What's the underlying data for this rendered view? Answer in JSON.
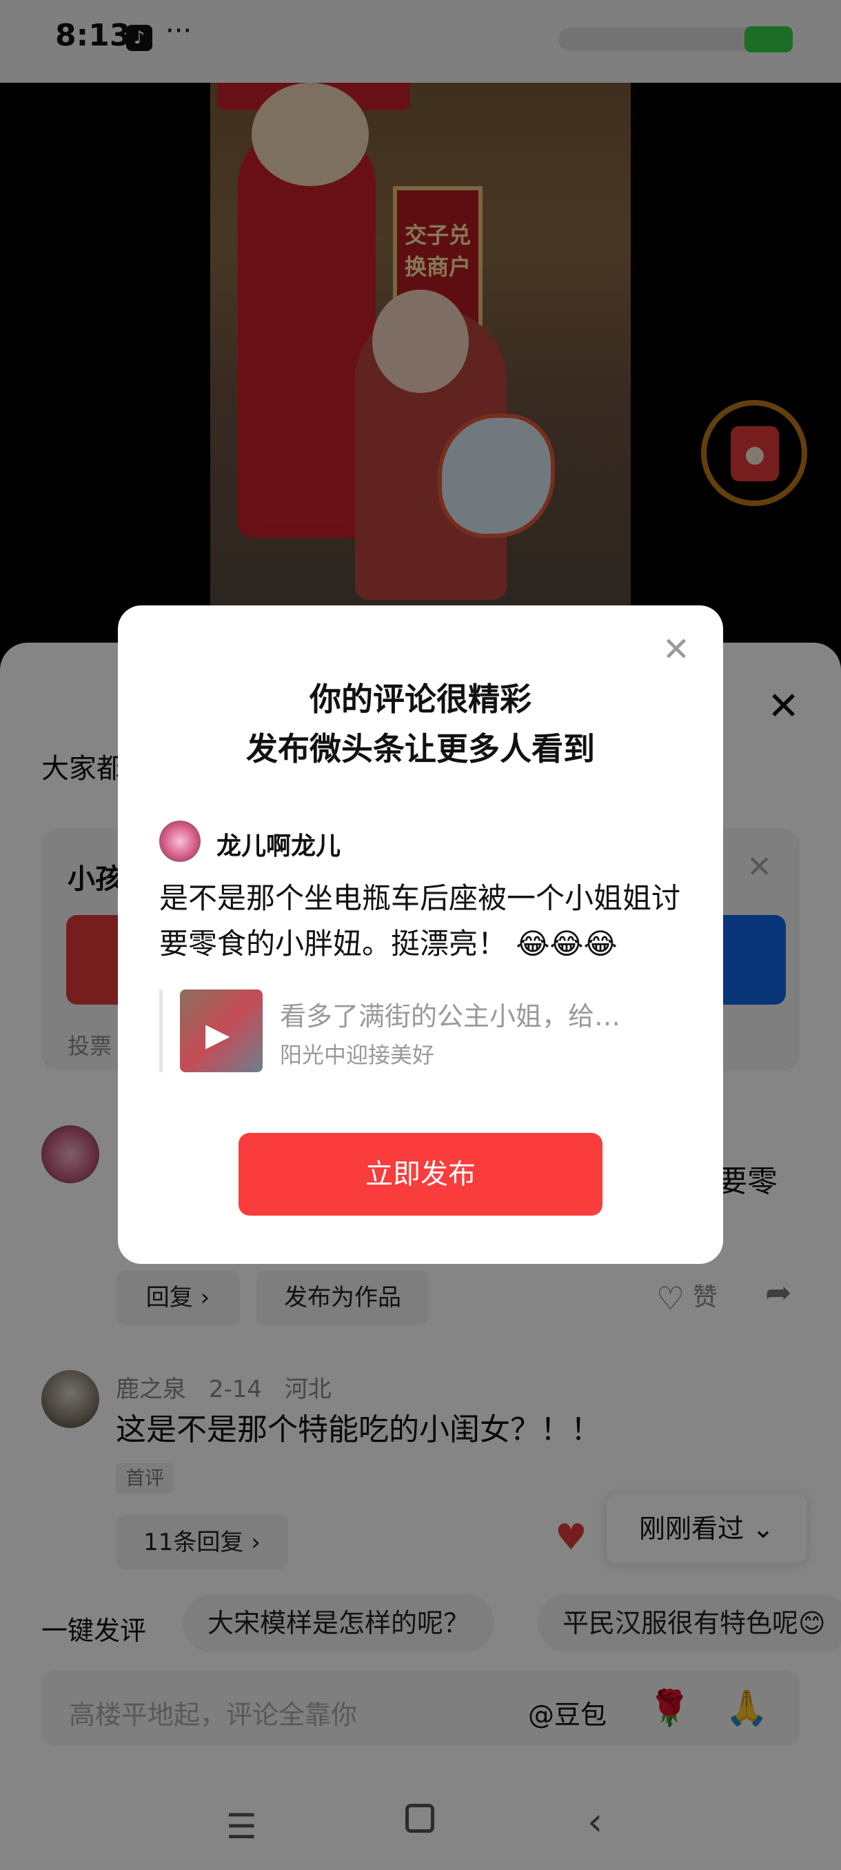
{
  "status": {
    "time": "8:13"
  },
  "comments_sheet": {
    "heading_partial": "大家都",
    "vote": {
      "title_partial": "小孩",
      "label_partial": "投票"
    },
    "comment1": {
      "tail_text": "要零",
      "reply_label": "回复 ›",
      "publish_as_work_label": "发布为作品",
      "like_label": "赞"
    },
    "comment2": {
      "user": "鹿之泉",
      "date": "2-14",
      "location": "河北",
      "text": "这是不是那个特能吃的小闺女？！！",
      "tag": "首评",
      "replies_label": "11条回复 ›"
    },
    "recently_viewed_label": "刚刚看过 ⌄"
  },
  "quick_comment": {
    "label": "一键发评",
    "chips": [
      "大宋模样是怎样的呢？",
      "平民汉服很有特色呢😊"
    ]
  },
  "input": {
    "placeholder": "高楼平地起，评论全靠你",
    "mention": "@豆包",
    "emoji1": "🌹",
    "emoji2": "🙏"
  },
  "dialog": {
    "title_line1": "你的评论很精彩",
    "title_line2": "发布微头条让更多人看到",
    "username": "龙儿啊龙儿",
    "comment_text": "是不是那个坐电瓶车后座被一个小姐姐讨要零食的小胖妞。挺漂亮！ 😂😂😂",
    "quoted_title": "看多了满街的公主小姐，给…",
    "quoted_author": "阳光中迎接美好",
    "publish_button": "立即发布"
  },
  "video_sign_text": "交子兑换商户",
  "colors": {
    "accent_red": "#fa3c3c",
    "vote_blue": "#1266e8",
    "status_green": "#38d24a"
  }
}
